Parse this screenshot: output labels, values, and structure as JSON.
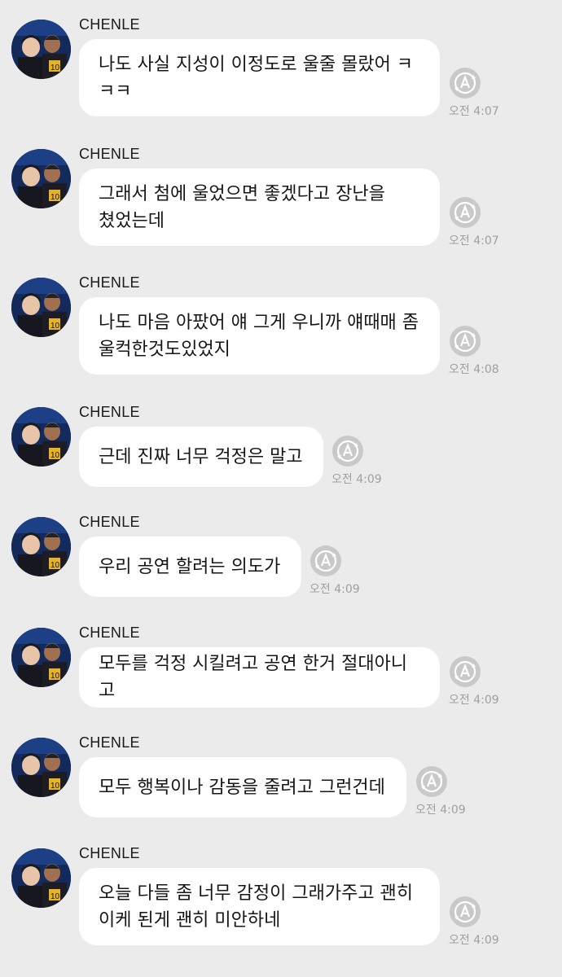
{
  "sender_name": "CHENLE",
  "messages": [
    {
      "text": "나도 사실 지성이 이정도로 울줄 몰랐어 ㅋ\nㅋㅋ",
      "time": "오전 4:07"
    },
    {
      "text": "그래서 첨에 울었으면 좋겠다고 장난을\n쳤었는데",
      "time": "오전 4:07"
    },
    {
      "text": "나도 마음 아팠어 얘 그게 우니까 얘때매 좀\n울컥한것도있었지",
      "time": "오전 4:08"
    },
    {
      "text": "근데 진짜 너무 걱정은 말고",
      "time": "오전 4:09"
    },
    {
      "text": "우리 공연 할려는 의도가",
      "time": "오전 4:09"
    },
    {
      "text": "모두를 걱정 시킬려고 공연 한거 절대아니고",
      "time": "오전 4:09"
    },
    {
      "text": "모두 행복이나 감동을 줄려고 그런건데",
      "time": "오전 4:09"
    },
    {
      "text": "오늘 다들 좀 너무 감정이 그래가주고 괜히\n이케 된게 괜히 미안하네",
      "time": "오전 4:09"
    }
  ],
  "icons": {
    "translate": "translate-icon",
    "avatar": "avatar"
  },
  "colors": {
    "background": "#ebebeb",
    "bubble": "#ffffff",
    "time": "#a0a0a0",
    "icon": "#c7c7c7"
  }
}
